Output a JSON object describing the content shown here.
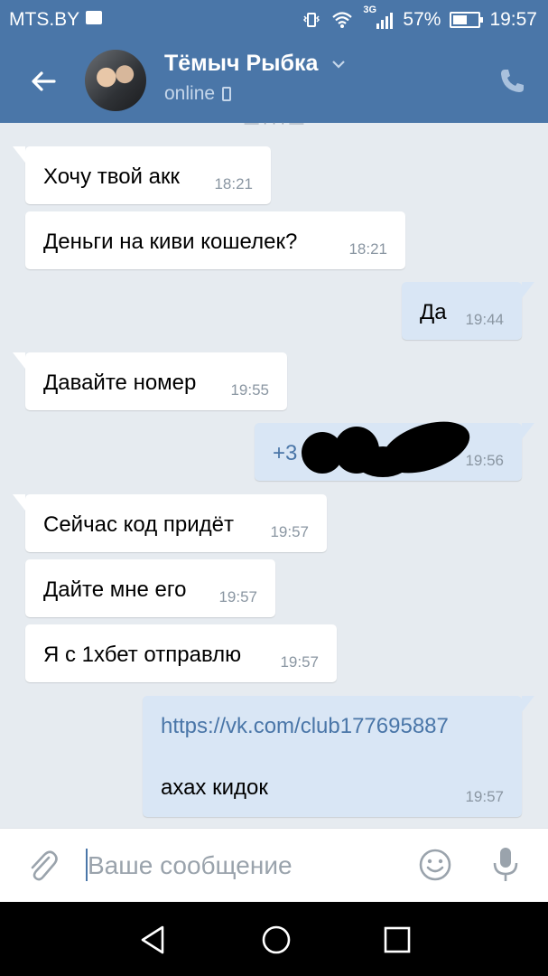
{
  "status_bar": {
    "carrier": "MTS.BY",
    "network": "3G",
    "battery": "57%",
    "battery_level": 0.57,
    "time": "19:57"
  },
  "header": {
    "contact_name": "Тёмыч Рыбка",
    "status": "online"
  },
  "messages": [
    {
      "direction": "in",
      "text": "Хочу твой акк",
      "time": "18:21"
    },
    {
      "direction": "in",
      "text": "Деньги на киви кошелек?",
      "time": "18:21"
    },
    {
      "direction": "out",
      "text": "Да",
      "time": "19:44"
    },
    {
      "direction": "in",
      "text": "Давайте номер",
      "time": "19:55"
    },
    {
      "direction": "out",
      "text": "+3",
      "time": "19:56",
      "redacted": true
    },
    {
      "direction": "in",
      "text": "Сейчас код придёт",
      "time": "19:57"
    },
    {
      "direction": "in",
      "text": "Дайте мне его",
      "time": "19:57"
    },
    {
      "direction": "in",
      "text": "Я с 1хбет отправлю",
      "time": "19:57"
    },
    {
      "direction": "out",
      "link": "https://vk.com/club177695887",
      "text": "ахах кидок",
      "time": "19:57"
    }
  ],
  "composer": {
    "placeholder": "Ваше сообщение"
  },
  "colors": {
    "brand": "#4a76a8",
    "chat_bg": "#e6ebf0",
    "outgoing_bubble": "#d9e6f5",
    "incoming_bubble": "#ffffff"
  },
  "icons": {
    "back": "arrow-left-icon",
    "call": "phone-icon",
    "attach": "paperclip-icon",
    "emoji": "smiley-icon",
    "mic": "microphone-icon"
  }
}
